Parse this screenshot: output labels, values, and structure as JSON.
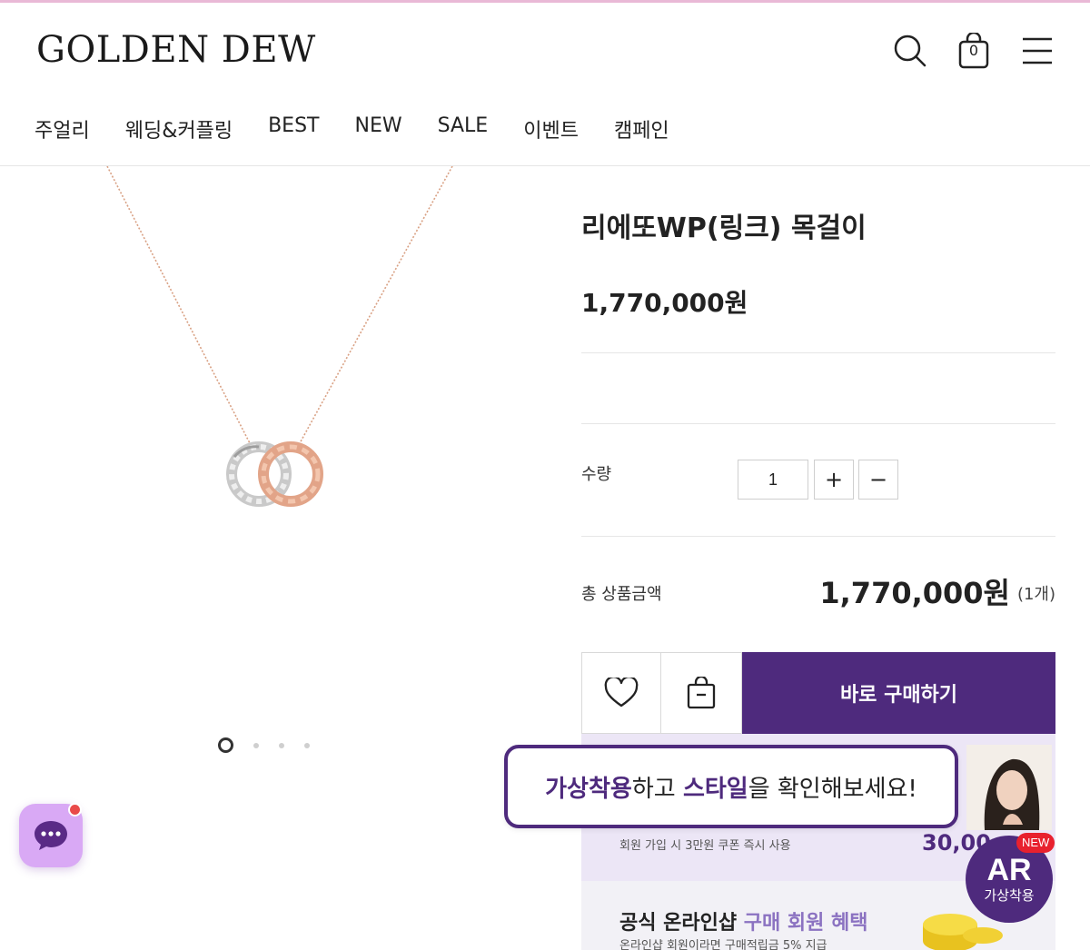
{
  "header": {
    "logo": "GOLDEN DEW",
    "cart_count": "0",
    "nav": [
      "주얼리",
      "웨딩&커플링",
      "BEST",
      "NEW",
      "SALE",
      "이벤트",
      "캠페인"
    ]
  },
  "product": {
    "name": "리에또WP(링크) 목걸이",
    "price": "1,770,000원",
    "image_pages": 4,
    "image_current": 1
  },
  "quantity": {
    "label": "수량",
    "value": "1",
    "plus": "+",
    "minus": "−"
  },
  "total": {
    "label": "총 상품금액",
    "amount": "1,770,000원",
    "count": "(1개)"
  },
  "actions": {
    "buy_now": "바로 구매하기",
    "wishlist_icon": "heart-icon",
    "cart_icon": "shopping-bag-icon"
  },
  "banners": {
    "signup_sub": "회원 가입 시 3만원 쿠폰 즉시 사용",
    "signup_amount": "30,00",
    "online_title_prefix": "공식 온라인샵",
    "online_title_highlight": "구매 회원 혜택",
    "online_sub": "온라인샵 회원이라면 구매적립금 5% 지급"
  },
  "tooltip": {
    "em1": "가상착용",
    "t1": "하고 ",
    "em2": "스타일",
    "t2": "을 확인해보세요!"
  },
  "ar_button": {
    "main": "AR",
    "sub": "가상착용",
    "badge": "NEW"
  },
  "colors": {
    "brand_purple": "#4e2a7d",
    "top_line": "#e9b9d6",
    "chat_bubble": "#d9a9f5",
    "badge_red": "#e8212e"
  }
}
